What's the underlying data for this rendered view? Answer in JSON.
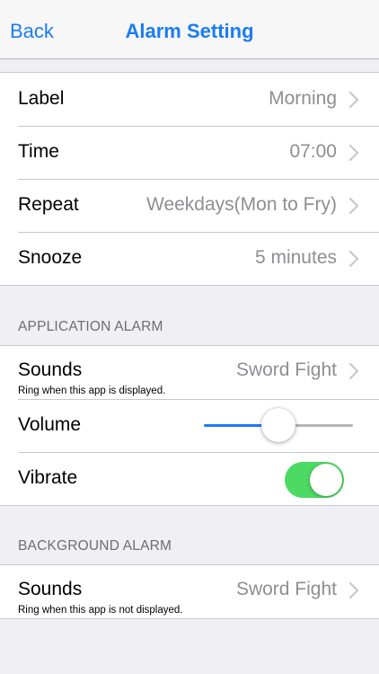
{
  "nav": {
    "back_label": "Back",
    "title": "Alarm Setting"
  },
  "general": {
    "rows": [
      {
        "label": "Label",
        "value": "Morning"
      },
      {
        "label": "Time",
        "value": "07:00"
      },
      {
        "label": "Repeat",
        "value": "Weekdays(Mon to Fry)"
      },
      {
        "label": "Snooze",
        "value": "5 minutes"
      }
    ]
  },
  "application_alarm": {
    "header": "APPLICATION ALARM",
    "sounds": {
      "label": "Sounds",
      "value": "Sword Fight",
      "sub": "Ring when this app is displayed."
    },
    "volume": {
      "label": "Volume",
      "level_fraction": 0.5
    },
    "vibrate": {
      "label": "Vibrate",
      "on": true
    }
  },
  "background_alarm": {
    "header": "BACKGROUND ALARM",
    "sounds": {
      "label": "Sounds",
      "value": "Sword Fight",
      "sub": "Ring when this app is not displayed."
    }
  },
  "colors": {
    "accent": "#1a7cf5",
    "toggle_on": "#4cd964",
    "secondary_text": "#8e8e93",
    "background": "#efeff4"
  },
  "icons": {
    "disclosure": "chevron-right-icon"
  }
}
